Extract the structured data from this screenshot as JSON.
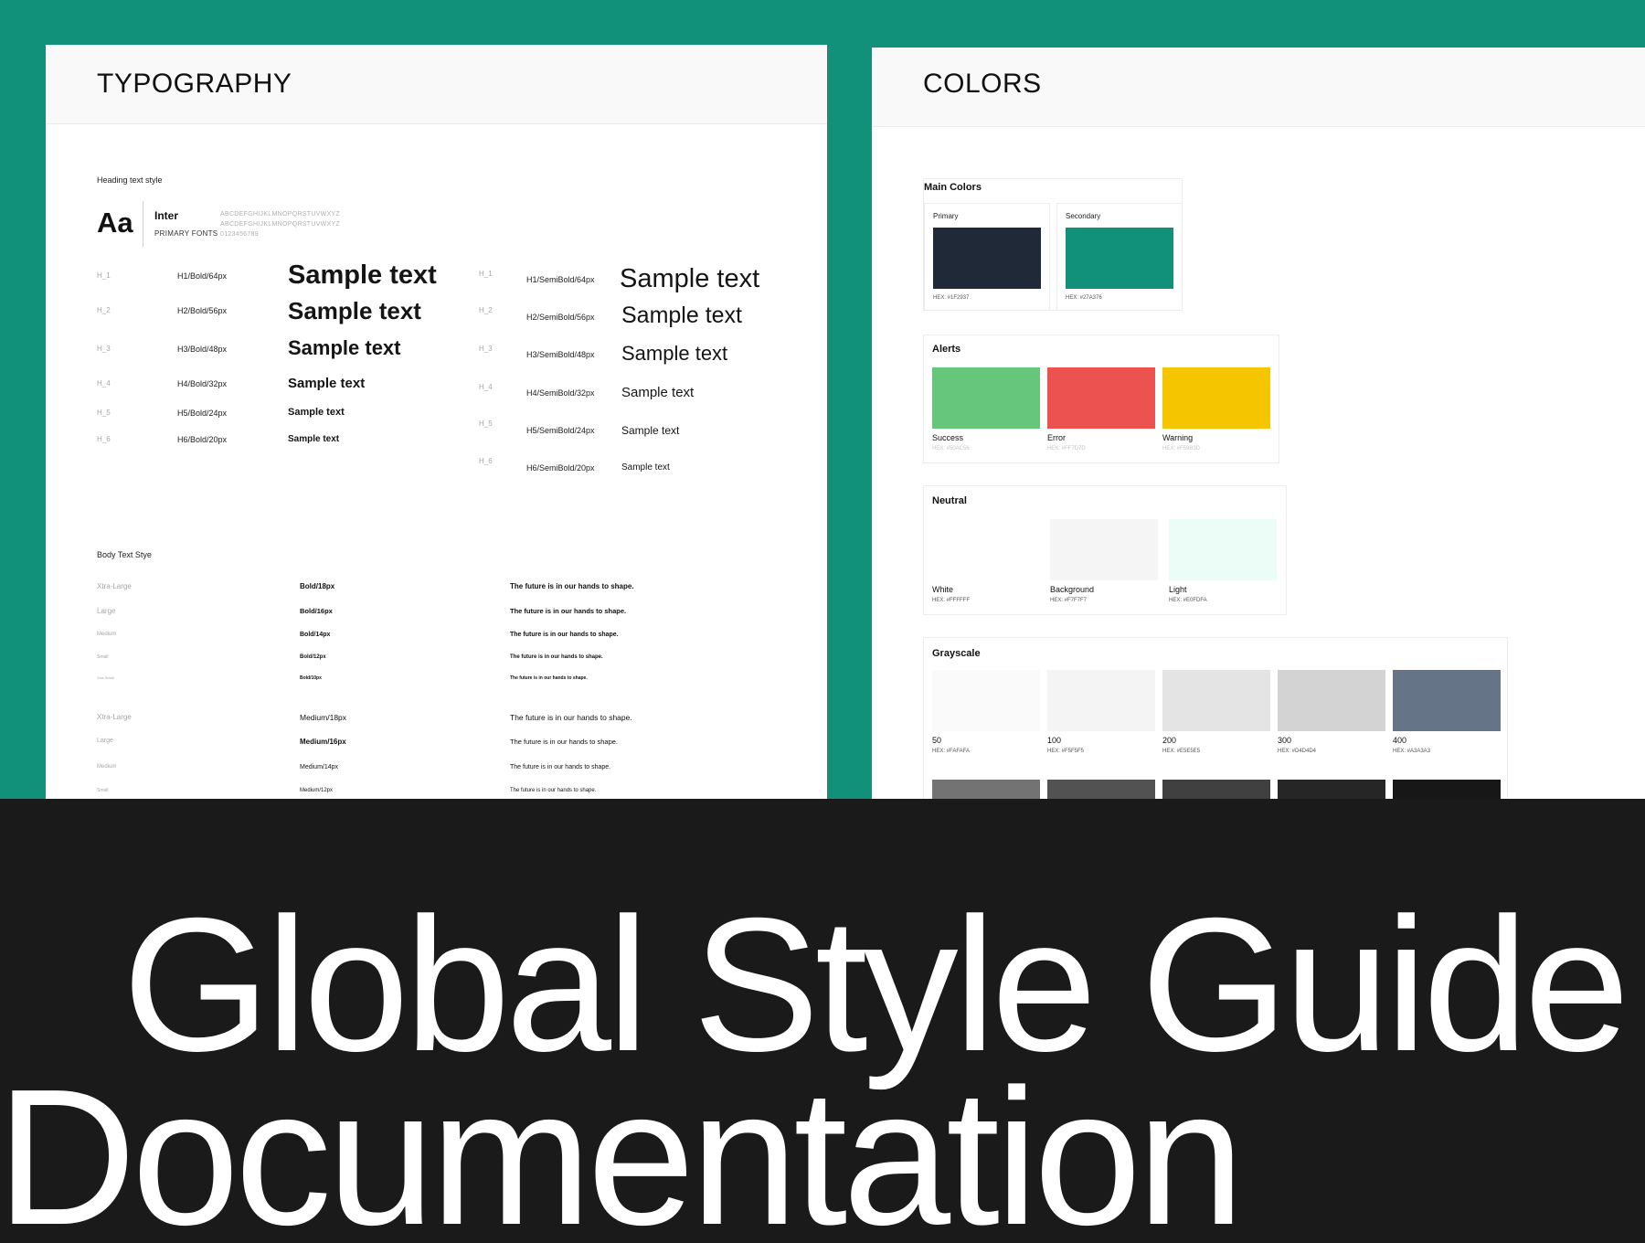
{
  "typography": {
    "title": "TYPOGRAPHY",
    "heading_section_label": "Heading text style",
    "font_sample": "Aa",
    "font_name": "Inter",
    "font_sub": "PRIMARY FONTS",
    "alphabet_upper": "ABCDEFGHIJKLMNOPQRSTUVWXYZ",
    "alphabet_lower": "ABCDEFGHIJKLMNOPQRSTUVWXYZ",
    "digits": "0123456789",
    "bold_headings": [
      {
        "code": "H_1",
        "spec": "H1/Bold/64px",
        "sample": "Sample text"
      },
      {
        "code": "H_2",
        "spec": "H2/Bold/56px",
        "sample": "Sample text"
      },
      {
        "code": "H_3",
        "spec": "H3/Bold/48px",
        "sample": "Sample text"
      },
      {
        "code": "H_4",
        "spec": "H4/Bold/32px",
        "sample": "Sample text"
      },
      {
        "code": "H_5",
        "spec": "H5/Bold/24px",
        "sample": "Sample text"
      },
      {
        "code": "H_6",
        "spec": "H6/Bold/20px",
        "sample": "Sample text"
      }
    ],
    "semibold_headings": [
      {
        "code": "H_1",
        "spec": "H1/SemiBold/64px",
        "sample": "Sample text"
      },
      {
        "code": "H_2",
        "spec": "H2/SemiBold/56px",
        "sample": "Sample text"
      },
      {
        "code": "H_3",
        "spec": "H3/SemiBold/48px",
        "sample": "Sample text"
      },
      {
        "code": "H_4",
        "spec": "H4/SemiBold/32px",
        "sample": "Sample text"
      },
      {
        "code": "H_5",
        "spec": "H5/SemiBold/24px",
        "sample": "Sample text"
      },
      {
        "code": "H_6",
        "spec": "H6/SemiBold/20px",
        "sample": "Sample text"
      }
    ],
    "body_section_label": "Body Text Stye",
    "body_bold": [
      {
        "size": "Xtra-Large",
        "spec": "Bold/18px",
        "sample": "The future is in our hands to shape."
      },
      {
        "size": "Large",
        "spec": "Bold/16px",
        "sample": "The future is in our hands to shape."
      },
      {
        "size": "Medium",
        "spec": "Bold/14px",
        "sample": "The future is in our hands to shape."
      },
      {
        "size": "Small",
        "spec": "Bold/12px",
        "sample": "The future is in our hands to shape."
      },
      {
        "size": "Xtra-Small",
        "spec": "Bold/10px",
        "sample": "The future is in our hands to shape."
      }
    ],
    "body_medium": [
      {
        "size": "Xtra-Large",
        "spec": "Medium/18px",
        "sample": "The future is in our hands to shape."
      },
      {
        "size": "Large",
        "spec": "Medium/16px",
        "sample": "The future is in our hands to shape."
      },
      {
        "size": "Medium",
        "spec": "Medium/14px",
        "sample": "The future is in our hands to shape."
      },
      {
        "size": "Small",
        "spec": "Medium/12px",
        "sample": "The future is in our hands to shape."
      }
    ]
  },
  "colors": {
    "title": "COLORS",
    "main": {
      "title": "Main Colors",
      "items": [
        {
          "label": "Primary",
          "hex_label": "HEX: #1F2937",
          "color": "#1f2937"
        },
        {
          "label": "Secondary",
          "hex_label": "HEX: #27A376",
          "color": "#11917a"
        }
      ]
    },
    "alerts": {
      "title": "Alerts",
      "items": [
        {
          "name": "Success",
          "hex_label": "HEX: #50AC56",
          "color": "#66c77c"
        },
        {
          "name": "Error",
          "hex_label": "HEX: #FF7D7D",
          "color": "#ec5350"
        },
        {
          "name": "Warning",
          "hex_label": "HEX: #F59B3D",
          "color": "#f5c600"
        }
      ]
    },
    "neutral": {
      "title": "Neutral",
      "items": [
        {
          "name": "White",
          "hex_label": "HEX: #FFFFFF",
          "color": "#ffffff"
        },
        {
          "name": "Background",
          "hex_label": "HEX: #F7F7F7",
          "color": "#f5f5f5"
        },
        {
          "name": "Light",
          "hex_label": "HEX: #E0FDFA",
          "color": "#ecfdf8"
        }
      ]
    },
    "grayscale": {
      "title": "Grayscale",
      "items": [
        {
          "name": "50",
          "hex_label": "HEX: #FAFAFA",
          "color": "#fafafa"
        },
        {
          "name": "100",
          "hex_label": "HEX: #F5F5F5",
          "color": "#f4f4f4"
        },
        {
          "name": "200",
          "hex_label": "HEX: #E5E5E5",
          "color": "#e4e4e4"
        },
        {
          "name": "300",
          "hex_label": "HEX: #D4D4D4",
          "color": "#d3d3d3"
        },
        {
          "name": "400",
          "hex_label": "HEX: #A3A3A3",
          "color": "#667487"
        }
      ],
      "row2_colors": [
        "#737373",
        "#525252",
        "#404040",
        "#262626",
        "#171717"
      ]
    }
  },
  "banner": {
    "line1": "Global Style Guide",
    "line2": "Documentation"
  }
}
